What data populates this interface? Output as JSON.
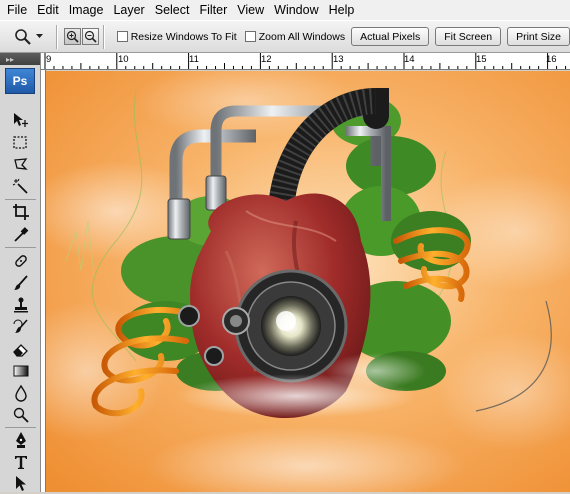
{
  "menu": [
    "File",
    "Edit",
    "Image",
    "Layer",
    "Select",
    "Filter",
    "View",
    "Window",
    "Help"
  ],
  "options": {
    "resize_windows": "Resize Windows To Fit",
    "zoom_all": "Zoom All Windows",
    "actual_pixels": "Actual Pixels",
    "fit_screen": "Fit Screen",
    "print_size": "Print Size"
  },
  "app_logo": "Ps",
  "ruler_numbers": [
    "9",
    "10",
    "11",
    "12",
    "13",
    "14",
    "15",
    "16"
  ],
  "tools": [
    "move-icon",
    "marquee-icon",
    "lasso-icon",
    "magic-wand-icon",
    "crop-icon",
    "eyedropper-icon",
    "healing-brush-icon",
    "brush-icon",
    "clone-stamp-icon",
    "history-brush-icon",
    "eraser-icon",
    "gradient-icon",
    "blur-icon",
    "dodge-icon",
    "pen-icon",
    "type-icon",
    "path-select-icon"
  ],
  "colors": {
    "sky": "#f4a04a",
    "sky_light": "#fbd7a6",
    "chrome": "#b9bdc2",
    "heart": "#9a2424"
  }
}
